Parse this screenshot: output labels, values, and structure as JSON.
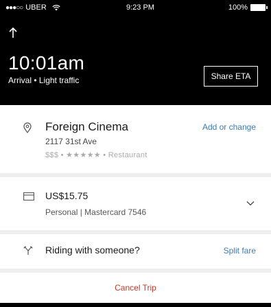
{
  "status_bar": {
    "carrier": "UBER",
    "time": "9:23 PM",
    "battery": "100%"
  },
  "trip": {
    "eta_time": "10:01am",
    "eta_sub": "Arrival • Light traffic",
    "share_label": "Share ETA"
  },
  "destination": {
    "name": "Foreign Cinema",
    "address": "2117 31st Ave",
    "meta": "$$$ • ★★★★★ • Restaurant",
    "action": "Add or change"
  },
  "payment": {
    "amount": "US$15.75",
    "method": "Personal | Mastercard 7546"
  },
  "split": {
    "label": "Riding with someone?",
    "action": "Split fare"
  },
  "cancel": {
    "label": "Cancel Trip"
  },
  "colors": {
    "header_bg": "#000000",
    "link": "#3b7bb5",
    "danger": "#c0392b",
    "divider": "#eeeeee"
  },
  "icons": {
    "direction": "up-arrow-icon",
    "destination": "location-pin-icon",
    "payment": "credit-card-icon",
    "expand": "chevron-down-icon",
    "split": "split-fare-icon",
    "signal": "signal-dots-icon",
    "wifi": "wifi-icon",
    "battery": "battery-icon"
  }
}
